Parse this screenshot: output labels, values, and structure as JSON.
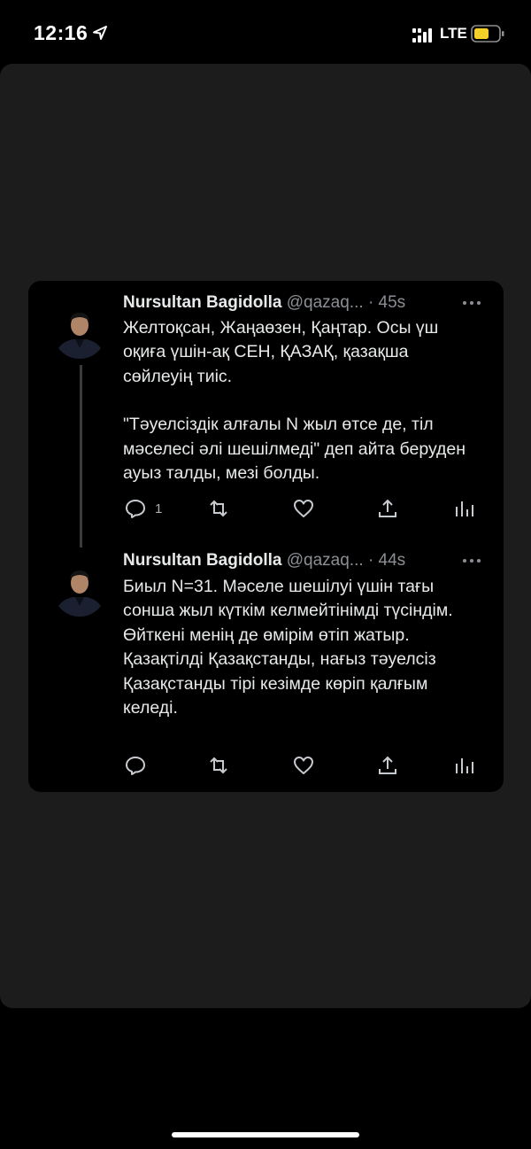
{
  "status_bar": {
    "time": "12:16",
    "network": "LTE",
    "icons": [
      "location-arrow-icon",
      "signal-icon",
      "battery-icon"
    ],
    "battery_color": "#f5d028"
  },
  "tweets": [
    {
      "author_name": "Nursultan Bagidolla",
      "handle": "@qazaq...",
      "time": "· 45s",
      "paragraphs": [
        "Желтоқсан, Жаңаөзен, Қаңтар. Осы үш оқиға үшін-ақ СЕН, ҚАЗАҚ, қазақша сөйлеуің тиіс.",
        "\"Тәуелсіздік алғалы N жыл өтсе де, тіл мәселесі әлі шешілмеді\" деп айта беруден ауыз талды, мезі болды."
      ],
      "reply_count": "1"
    },
    {
      "author_name": "Nursultan Bagidolla",
      "handle": "@qazaq...",
      "time": "· 44s",
      "paragraphs": [
        "Биыл N=31. Мәселе шешілуі үшін тағы сонша жыл күткім келмейтінімді түсіндім. Өйткені менің де өмірім өтіп жатыр. Қазақтілді Қазақстанды, нағыз тәуелсіз Қазақстанды тірі кезімде көріп қалғым келеді."
      ],
      "reply_count": ""
    }
  ],
  "colors": {
    "sheet_background": "#1c1c1c",
    "card_background": "#000000",
    "secondary_text": "#8b8f94"
  }
}
